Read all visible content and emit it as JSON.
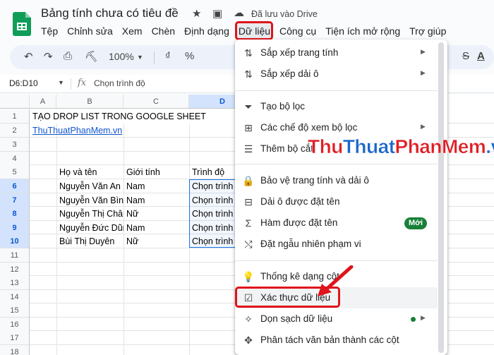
{
  "title_bar": {
    "doc_title": "Bảng tính chưa có tiêu đề",
    "saved_status": "Đã lưu vào Drive",
    "star_icon": "★",
    "folder_icon": "▣",
    "cloud_icon": "☁"
  },
  "menubar": [
    "Tệp",
    "Chỉnh sửa",
    "Xem",
    "Chèn",
    "Định dạng",
    "Dữ liệu",
    "Công cụ",
    "Tiện ích mở rộng",
    "Trợ giúp"
  ],
  "toolbar": {
    "zoom": "100%",
    "undo": "↶",
    "redo": "↷",
    "print": "⎙",
    "paint": "⛏",
    "currency": "₫",
    "percent": "%",
    "strikethrough": "S",
    "text_color": "A"
  },
  "formula_bar": {
    "name_box": "D6:D10",
    "fx": "fx",
    "content": "Chọn trình độ"
  },
  "columns": [
    "A",
    "B",
    "C",
    "D"
  ],
  "rows": [
    "1",
    "2",
    "3",
    "4",
    "5",
    "6",
    "7",
    "8",
    "9",
    "10",
    "11",
    "12",
    "13",
    "14",
    "15",
    "16",
    "17",
    "18"
  ],
  "cells": {
    "a1": "TẠO DROP LIST TRONG GOOGLE SHEET",
    "a2": "ThuThuatPhanMem.vn",
    "b5": "Họ và tên",
    "c5": "Giới tính",
    "d5": "Trình độ",
    "b6": "Nguyễn Văn An",
    "c6": "Nam",
    "d6": "Chọn trình độ",
    "b7": "Nguyễn Văn Bình",
    "c7": "Nam",
    "d7": "Chọn trình độ",
    "b8": "Nguyễn Thị Châu",
    "c8": "Nữ",
    "d8": "Chọn trình độ",
    "b9": "Nguyễn Đức Dũng",
    "c9": "Nam",
    "d9": "Chọn trình độ",
    "b10": "Bùi Thị Duyên",
    "c10": "Nữ",
    "d10": "Chọn trình độ"
  },
  "data_menu": {
    "items": [
      {
        "icon": "⇅",
        "label": "Sắp xếp trang tính"
      },
      {
        "icon": "⇅",
        "label": "Sắp xếp dải ô"
      },
      {
        "icon": "⏷",
        "label": "Tạo bộ lọc"
      },
      {
        "icon": "⊞",
        "label": "Các chế độ xem bộ lọc"
      },
      {
        "icon": "☰",
        "label": "Thêm bộ cắt"
      },
      {
        "icon": "🔒",
        "label": "Bảo vệ trang tính và dải ô"
      },
      {
        "icon": "⊟",
        "label": "Dải ô được đặt tên"
      },
      {
        "icon": "Σ",
        "label": "Hàm được đặt tên",
        "badge": "Mới"
      },
      {
        "icon": "⤭",
        "label": "Đặt ngẫu nhiên phạm vi"
      },
      {
        "icon": "💡",
        "label": "Thống kê dạng cột"
      },
      {
        "icon": "☑",
        "label": "Xác thực dữ liệu"
      },
      {
        "icon": "✧",
        "label": "Dọn sạch dữ liệu"
      },
      {
        "icon": "✥",
        "label": "Phân tách văn bản thành các cột"
      }
    ],
    "submenu_arrow": "▶"
  },
  "watermark": {
    "part1": "Thu",
    "part2": "Thuat",
    "part3": "PhanMem",
    "part4": ".vn"
  },
  "colors": {
    "highlight_red": "#e0141b",
    "sheets_green": "#0f9d58",
    "selection_blue": "#1a73e8",
    "badge_green": "#188038"
  }
}
